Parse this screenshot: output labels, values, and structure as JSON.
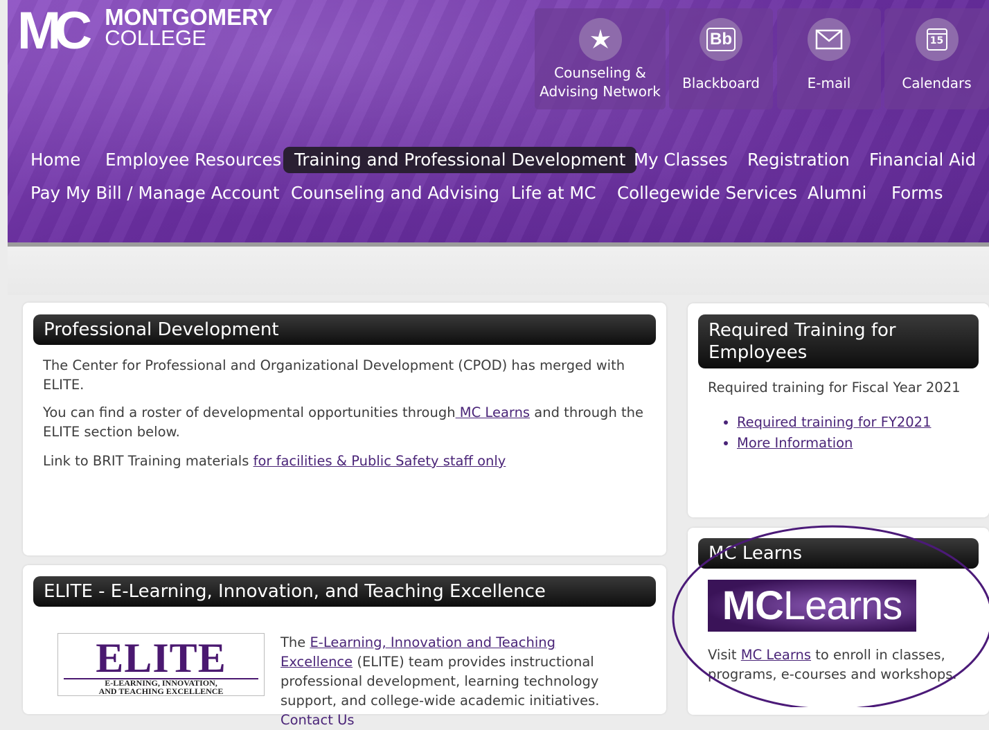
{
  "logo": {
    "mark": "MC",
    "line1": "MONTGOMERY",
    "line2": "COLLEGE"
  },
  "quick_links": [
    {
      "label_line1": "Counseling &",
      "label_line2": "Advising Network",
      "icon": "star-icon"
    },
    {
      "label": "Blackboard",
      "icon": "blackboard-icon",
      "icon_text": "Bb"
    },
    {
      "label": "E-mail",
      "icon": "envelope-icon"
    },
    {
      "label": "Calendars",
      "icon": "calendar-icon",
      "icon_text": "15"
    }
  ],
  "nav": {
    "row1": [
      "Home",
      "Employee Resources",
      "Training and Professional Development",
      "My Classes",
      "Registration",
      "Financial Aid"
    ],
    "row2": [
      "Pay My Bill / Manage Account",
      "Counseling and Advising",
      "Life at MC",
      "Collegewide Services",
      "Alumni",
      "Forms"
    ],
    "active": "Training and Professional Development"
  },
  "professional_development": {
    "title": "Professional Development",
    "p1": "The Center for Professional and Organizational Development (CPOD) has merged with ELITE.",
    "p2_before": "You can find a roster of developmental opportunities through",
    "p2_link": " MC Learns",
    "p2_after": " and through the ELITE section below.",
    "p3_before": "Link to BRIT Training materials ",
    "p3_link": "for facilities & Public Safety staff only"
  },
  "elite": {
    "title": "ELITE - E-Learning, Innovation, and Teaching Excellence",
    "logo_main": "ELITE",
    "logo_sub1": "E-LEARNING, INNOVATION,",
    "logo_sub2": "AND TEACHING EXCELLENCE",
    "text_before": "The ",
    "text_link": "E-Learning, Innovation and Teaching Excellence",
    "text_after": " (ELITE) team provides instructional professional development, learning technology support, and college-wide academic initiatives.  ",
    "contact_link": "Contact Us"
  },
  "required_training": {
    "title": "Required Training for Employees",
    "intro": "Required training for Fiscal Year 2021",
    "links": [
      "Required training for FY2021",
      "More Information"
    ]
  },
  "mc_learns": {
    "title": "MC Learns",
    "banner_mc": "MC",
    "banner_learns": "Learns",
    "text_before": "Visit ",
    "text_link": "MC Learns",
    "text_after": " to enroll in classes, programs, e-courses and workshops."
  },
  "colors": {
    "purple": "#6a2fa0",
    "link": "#4a2478",
    "annotation": "#4b1a78"
  }
}
